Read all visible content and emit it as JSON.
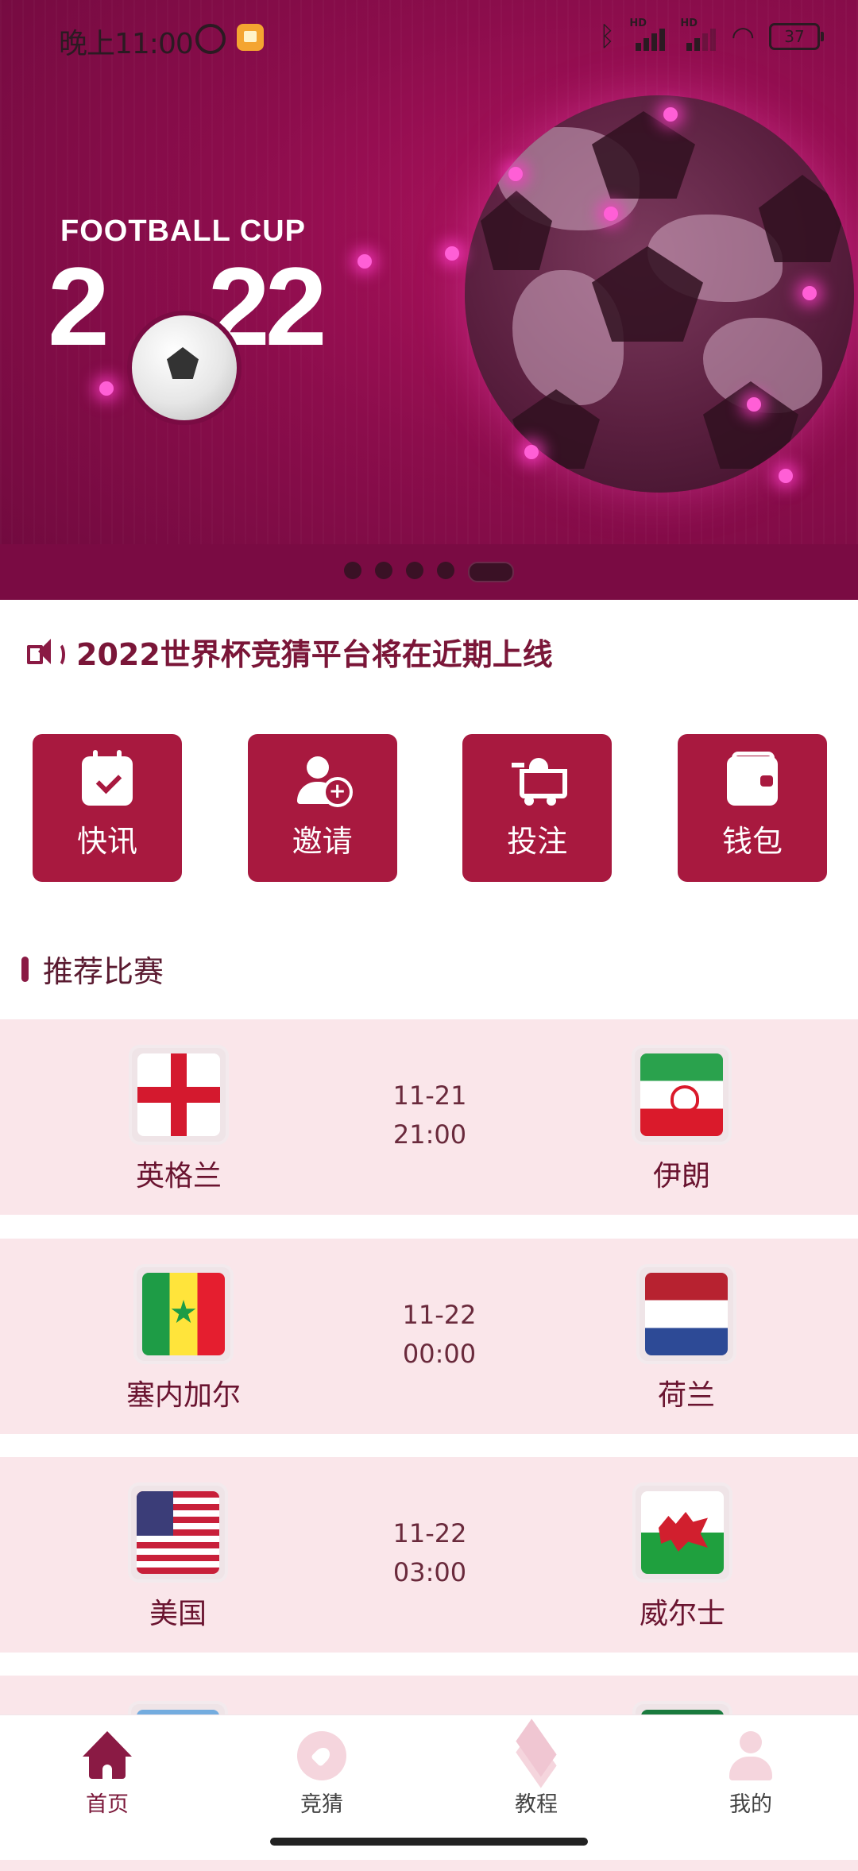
{
  "status_bar": {
    "time": "晚上11:00",
    "signal1_tag": "HD",
    "signal2_tag": "HD",
    "battery": "37"
  },
  "banner": {
    "subtitle": "FOOTBALL CUP",
    "year_left": "2",
    "year_right": "22",
    "slide_count": 5,
    "active_slide": 5
  },
  "announcement": {
    "icon": "speaker-icon",
    "text": "2022世界杯竞猜平台将在近期上线"
  },
  "actions": [
    {
      "label": "快讯",
      "icon": "calendar-check-icon"
    },
    {
      "label": "邀请",
      "icon": "add-user-icon"
    },
    {
      "label": "投注",
      "icon": "cart-icon"
    },
    {
      "label": "钱包",
      "icon": "wallet-icon"
    }
  ],
  "section": {
    "title": "推荐比赛"
  },
  "matches": [
    {
      "home": "英格兰",
      "away": "伊朗",
      "date": "11-21",
      "time": "21:00"
    },
    {
      "home": "塞内加尔",
      "away": "荷兰",
      "date": "11-22",
      "time": "00:00"
    },
    {
      "home": "美国",
      "away": "威尔士",
      "date": "11-22",
      "time": "03:00"
    }
  ],
  "bottom_nav": [
    {
      "label": "首页",
      "icon": "home-icon",
      "active": true
    },
    {
      "label": "竞猜",
      "icon": "football-icon",
      "active": false
    },
    {
      "label": "教程",
      "icon": "layers-icon",
      "active": false
    },
    {
      "label": "我的",
      "icon": "profile-icon",
      "active": false
    }
  ],
  "colors": {
    "brand": "#a8193f",
    "banner": "#8c0d4c",
    "match_bg": "#fae6ea",
    "text_dark": "#7a1638"
  }
}
